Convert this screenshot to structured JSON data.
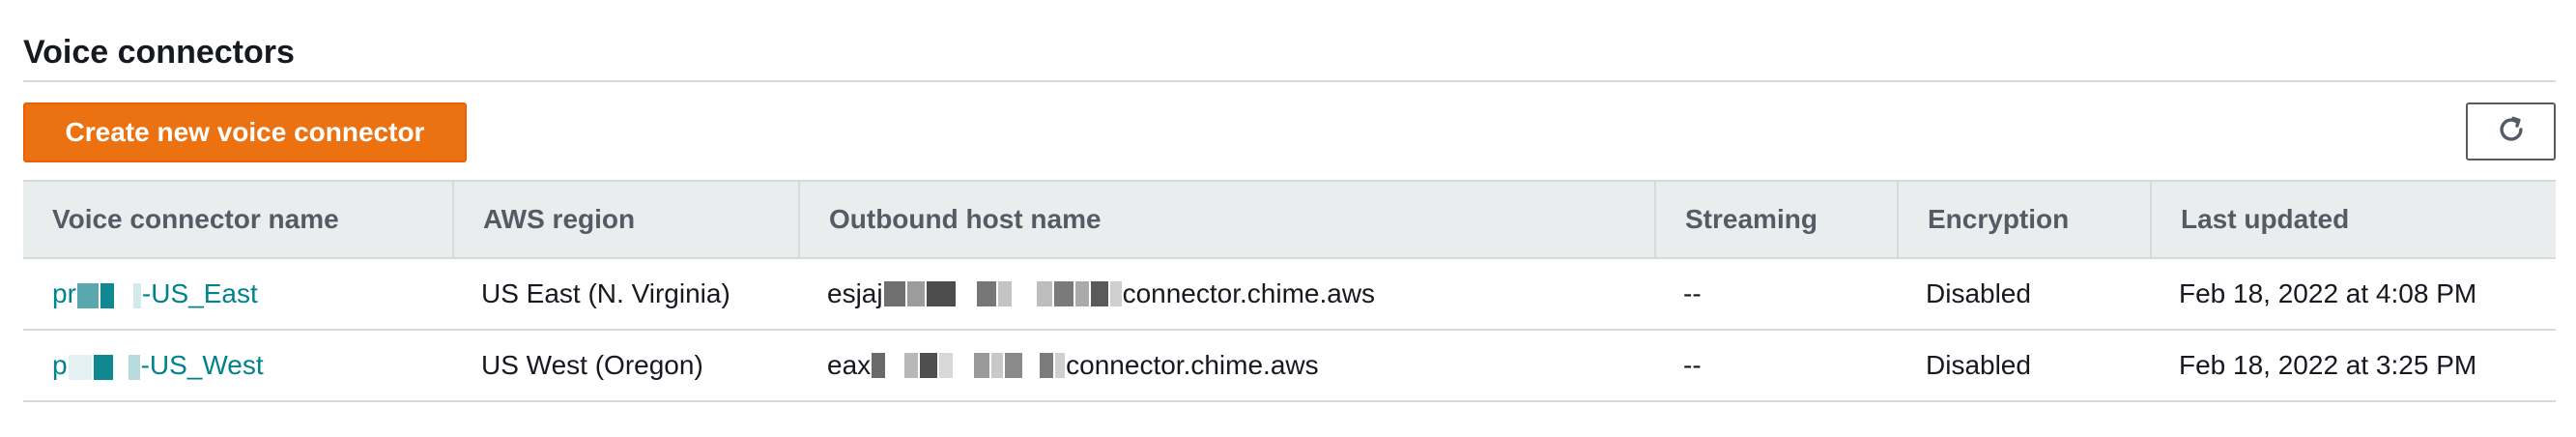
{
  "section": {
    "title": "Voice connectors"
  },
  "toolbar": {
    "create_label": "Create new voice connector",
    "refresh_icon": "refresh-icon"
  },
  "table": {
    "columns": [
      "Voice connector name",
      "AWS region",
      "Outbound host name",
      "Streaming",
      "Encryption",
      "Last updated"
    ],
    "rows": [
      {
        "name_prefix": "pr",
        "name_suffix": "-US_East",
        "region": "US East (N. Virginia)",
        "host_prefix": "esjaj",
        "host_suffix": "connector.chime.aws",
        "streaming": "--",
        "encryption": "Disabled",
        "last_updated": "Feb 18, 2022 at 4:08 PM"
      },
      {
        "name_prefix": "p",
        "name_suffix": "-US_West",
        "region": "US West (Oregon)",
        "host_prefix": "eax",
        "host_suffix": "connector.chime.aws",
        "streaming": "--",
        "encryption": "Disabled",
        "last_updated": "Feb 18, 2022 at 3:25 PM"
      }
    ]
  },
  "colors": {
    "primary_button": "#ec7211",
    "link": "#00838f",
    "header_bg": "#eaeded",
    "border": "#d5dbdb"
  }
}
